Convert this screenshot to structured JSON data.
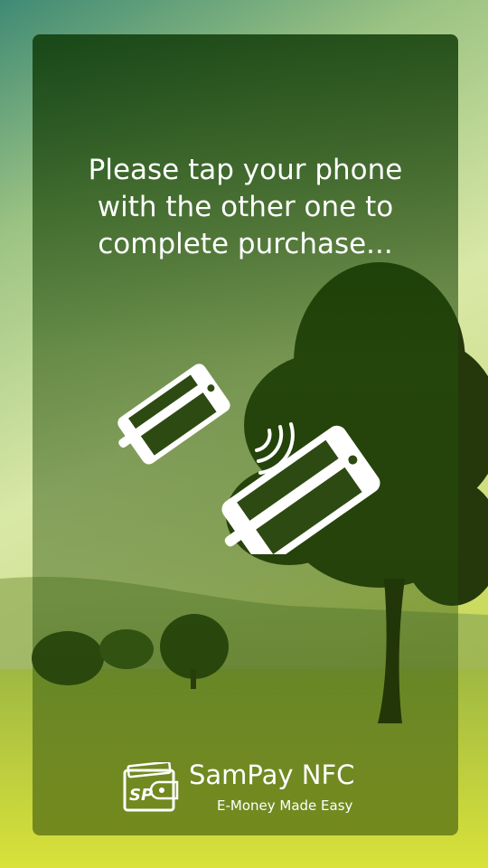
{
  "screen": {
    "message": "Please tap your phone\nwith the other one to\ncomplete purchase..."
  },
  "brand": {
    "name": "SamPay NFC",
    "tagline": "E-Money Made Easy",
    "logo_letters": "SP"
  },
  "icons": {
    "illustration": "phones-nfc-tap-icon",
    "logo": "wallet-logo-icon"
  },
  "colors": {
    "text": "#ffffff",
    "panel_overlay": "#1e4a08"
  }
}
